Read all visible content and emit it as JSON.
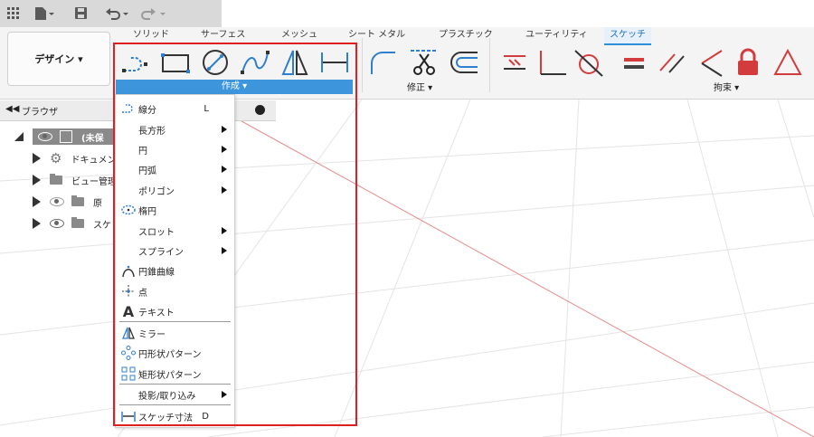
{
  "tabs": [
    "ソリッド",
    "サーフェス",
    "メッシュ",
    "シート メタル",
    "プラスチック",
    "ユーティリティ",
    "スケッチ"
  ],
  "design_button": "デザイン ▾",
  "groups": {
    "create": "作成 ▾",
    "modify": "修正 ▾",
    "constrain": "拘束 ▾"
  },
  "browser": {
    "title": "ブラウザ",
    "rows": [
      {
        "label": "(未保"
      },
      {
        "label": "ドキュメン"
      },
      {
        "label": "ビュー管理"
      },
      {
        "label": "原"
      },
      {
        "label": "スケ"
      }
    ]
  },
  "menu": {
    "items": [
      {
        "label": "線分",
        "shortcut": "L",
        "icon": "line-icon"
      },
      {
        "label": "長方形",
        "submenu": true
      },
      {
        "label": "円",
        "submenu": true
      },
      {
        "label": "円弧",
        "submenu": true
      },
      {
        "label": "ポリゴン",
        "submenu": true
      },
      {
        "label": "楕円",
        "icon": "ellipse-icon"
      },
      {
        "label": "スロット",
        "submenu": true
      },
      {
        "label": "スプライン",
        "submenu": true
      },
      {
        "label": "円錐曲線",
        "icon": "conic-icon"
      },
      {
        "label": "点",
        "icon": "point-icon"
      },
      {
        "label": "テキスト",
        "icon": "text-icon"
      },
      {
        "label": "ミラー",
        "icon": "mirror-icon"
      },
      {
        "label": "円形状パターン",
        "icon": "circular-pattern-icon"
      },
      {
        "label": "矩形状パターン",
        "icon": "rectangular-pattern-icon"
      },
      {
        "label": "投影/取り込み",
        "submenu": true
      },
      {
        "label": "スケッチ寸法",
        "shortcut": "D",
        "icon": "dimension-icon"
      }
    ]
  },
  "colors": {
    "accent": "#3d96dc",
    "highlight_frame": "#e02020",
    "constraint_red": "#d33c3c",
    "tool_blue": "#2f7fd0"
  }
}
